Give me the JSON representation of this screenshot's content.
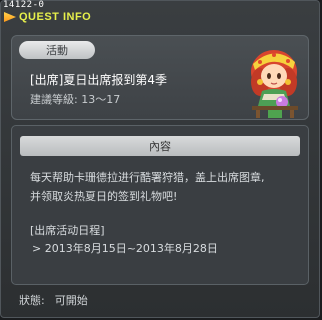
{
  "window": {
    "quest_id": "14122-0",
    "title": "QUEST INFO"
  },
  "quest": {
    "badge": "活動",
    "title": "[出席]夏日出席报到第4季",
    "level": "建議等級: 13～17"
  },
  "content": {
    "header": "內容",
    "description_line1": "每天帮助卡珊德拉进行酷署狩猎，盖上出席图章,",
    "description_line2": "并领取炎热夏日的签到礼物吧!",
    "schedule_title": "[出席活动日程]",
    "schedule_date": "> 2013年8月15日~2013年8月28日"
  },
  "status": {
    "label": "狀態:",
    "value": "可開始"
  },
  "icons": {
    "title_icon": "arrow-icon",
    "npc": "npc-portrait"
  },
  "colors": {
    "title": "#e7f04b",
    "badge_bg": "#d4d6d8",
    "panel": "#3e4246"
  }
}
